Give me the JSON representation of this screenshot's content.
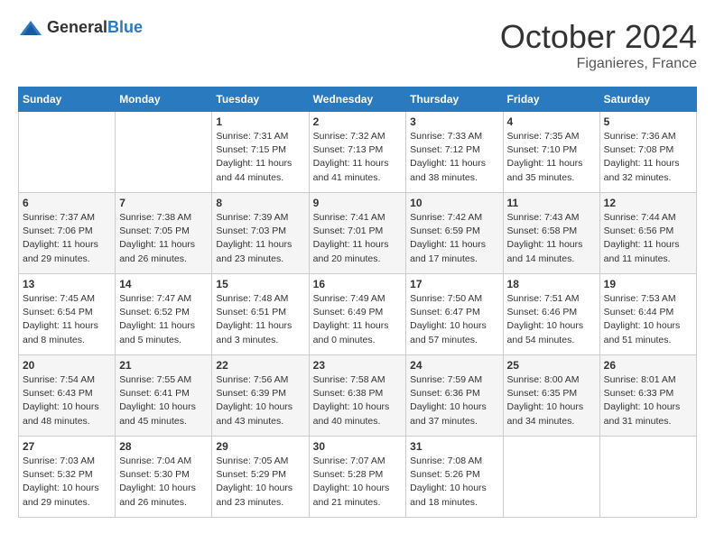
{
  "header": {
    "logo_general": "General",
    "logo_blue": "Blue",
    "month": "October 2024",
    "location": "Figanieres, France"
  },
  "columns": [
    "Sunday",
    "Monday",
    "Tuesday",
    "Wednesday",
    "Thursday",
    "Friday",
    "Saturday"
  ],
  "weeks": [
    [
      {
        "day": "",
        "info": ""
      },
      {
        "day": "",
        "info": ""
      },
      {
        "day": "1",
        "info": "Sunrise: 7:31 AM\nSunset: 7:15 PM\nDaylight: 11 hours and 44 minutes."
      },
      {
        "day": "2",
        "info": "Sunrise: 7:32 AM\nSunset: 7:13 PM\nDaylight: 11 hours and 41 minutes."
      },
      {
        "day": "3",
        "info": "Sunrise: 7:33 AM\nSunset: 7:12 PM\nDaylight: 11 hours and 38 minutes."
      },
      {
        "day": "4",
        "info": "Sunrise: 7:35 AM\nSunset: 7:10 PM\nDaylight: 11 hours and 35 minutes."
      },
      {
        "day": "5",
        "info": "Sunrise: 7:36 AM\nSunset: 7:08 PM\nDaylight: 11 hours and 32 minutes."
      }
    ],
    [
      {
        "day": "6",
        "info": "Sunrise: 7:37 AM\nSunset: 7:06 PM\nDaylight: 11 hours and 29 minutes."
      },
      {
        "day": "7",
        "info": "Sunrise: 7:38 AM\nSunset: 7:05 PM\nDaylight: 11 hours and 26 minutes."
      },
      {
        "day": "8",
        "info": "Sunrise: 7:39 AM\nSunset: 7:03 PM\nDaylight: 11 hours and 23 minutes."
      },
      {
        "day": "9",
        "info": "Sunrise: 7:41 AM\nSunset: 7:01 PM\nDaylight: 11 hours and 20 minutes."
      },
      {
        "day": "10",
        "info": "Sunrise: 7:42 AM\nSunset: 6:59 PM\nDaylight: 11 hours and 17 minutes."
      },
      {
        "day": "11",
        "info": "Sunrise: 7:43 AM\nSunset: 6:58 PM\nDaylight: 11 hours and 14 minutes."
      },
      {
        "day": "12",
        "info": "Sunrise: 7:44 AM\nSunset: 6:56 PM\nDaylight: 11 hours and 11 minutes."
      }
    ],
    [
      {
        "day": "13",
        "info": "Sunrise: 7:45 AM\nSunset: 6:54 PM\nDaylight: 11 hours and 8 minutes."
      },
      {
        "day": "14",
        "info": "Sunrise: 7:47 AM\nSunset: 6:52 PM\nDaylight: 11 hours and 5 minutes."
      },
      {
        "day": "15",
        "info": "Sunrise: 7:48 AM\nSunset: 6:51 PM\nDaylight: 11 hours and 3 minutes."
      },
      {
        "day": "16",
        "info": "Sunrise: 7:49 AM\nSunset: 6:49 PM\nDaylight: 11 hours and 0 minutes."
      },
      {
        "day": "17",
        "info": "Sunrise: 7:50 AM\nSunset: 6:47 PM\nDaylight: 10 hours and 57 minutes."
      },
      {
        "day": "18",
        "info": "Sunrise: 7:51 AM\nSunset: 6:46 PM\nDaylight: 10 hours and 54 minutes."
      },
      {
        "day": "19",
        "info": "Sunrise: 7:53 AM\nSunset: 6:44 PM\nDaylight: 10 hours and 51 minutes."
      }
    ],
    [
      {
        "day": "20",
        "info": "Sunrise: 7:54 AM\nSunset: 6:43 PM\nDaylight: 10 hours and 48 minutes."
      },
      {
        "day": "21",
        "info": "Sunrise: 7:55 AM\nSunset: 6:41 PM\nDaylight: 10 hours and 45 minutes."
      },
      {
        "day": "22",
        "info": "Sunrise: 7:56 AM\nSunset: 6:39 PM\nDaylight: 10 hours and 43 minutes."
      },
      {
        "day": "23",
        "info": "Sunrise: 7:58 AM\nSunset: 6:38 PM\nDaylight: 10 hours and 40 minutes."
      },
      {
        "day": "24",
        "info": "Sunrise: 7:59 AM\nSunset: 6:36 PM\nDaylight: 10 hours and 37 minutes."
      },
      {
        "day": "25",
        "info": "Sunrise: 8:00 AM\nSunset: 6:35 PM\nDaylight: 10 hours and 34 minutes."
      },
      {
        "day": "26",
        "info": "Sunrise: 8:01 AM\nSunset: 6:33 PM\nDaylight: 10 hours and 31 minutes."
      }
    ],
    [
      {
        "day": "27",
        "info": "Sunrise: 7:03 AM\nSunset: 5:32 PM\nDaylight: 10 hours and 29 minutes."
      },
      {
        "day": "28",
        "info": "Sunrise: 7:04 AM\nSunset: 5:30 PM\nDaylight: 10 hours and 26 minutes."
      },
      {
        "day": "29",
        "info": "Sunrise: 7:05 AM\nSunset: 5:29 PM\nDaylight: 10 hours and 23 minutes."
      },
      {
        "day": "30",
        "info": "Sunrise: 7:07 AM\nSunset: 5:28 PM\nDaylight: 10 hours and 21 minutes."
      },
      {
        "day": "31",
        "info": "Sunrise: 7:08 AM\nSunset: 5:26 PM\nDaylight: 10 hours and 18 minutes."
      },
      {
        "day": "",
        "info": ""
      },
      {
        "day": "",
        "info": ""
      }
    ]
  ]
}
